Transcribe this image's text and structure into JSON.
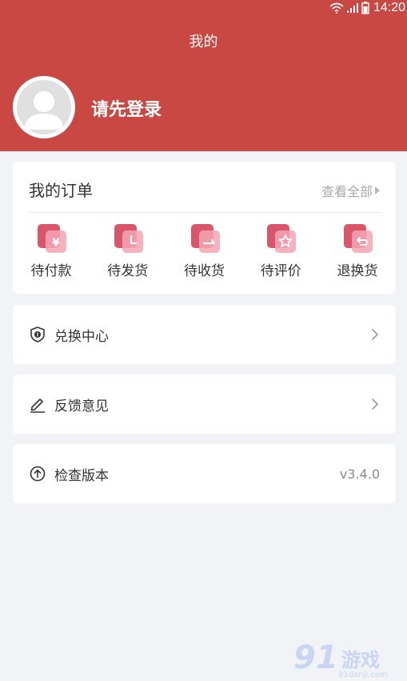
{
  "status_bar": {
    "time": "14:20"
  },
  "header": {
    "title": "我的",
    "login_prompt": "请先登录"
  },
  "orders": {
    "title": "我的订单",
    "view_all": "查看全部",
    "items": [
      {
        "label": "待付款",
        "icon": "yen-icon"
      },
      {
        "label": "待发货",
        "icon": "clock-icon"
      },
      {
        "label": "待收货",
        "icon": "receive-icon"
      },
      {
        "label": "待评价",
        "icon": "star-icon"
      },
      {
        "label": "退换货",
        "icon": "return-icon"
      }
    ]
  },
  "menu": {
    "exchange": {
      "label": "兑换中心"
    },
    "feedback": {
      "label": "反馈意见"
    },
    "version": {
      "label": "检查版本",
      "value": "v3.4.0"
    }
  },
  "colors": {
    "primary": "#c94843",
    "background": "#f1f3f7",
    "card": "#ffffff"
  },
  "watermark": {
    "text": "游戏",
    "domain": "91danji.com"
  }
}
